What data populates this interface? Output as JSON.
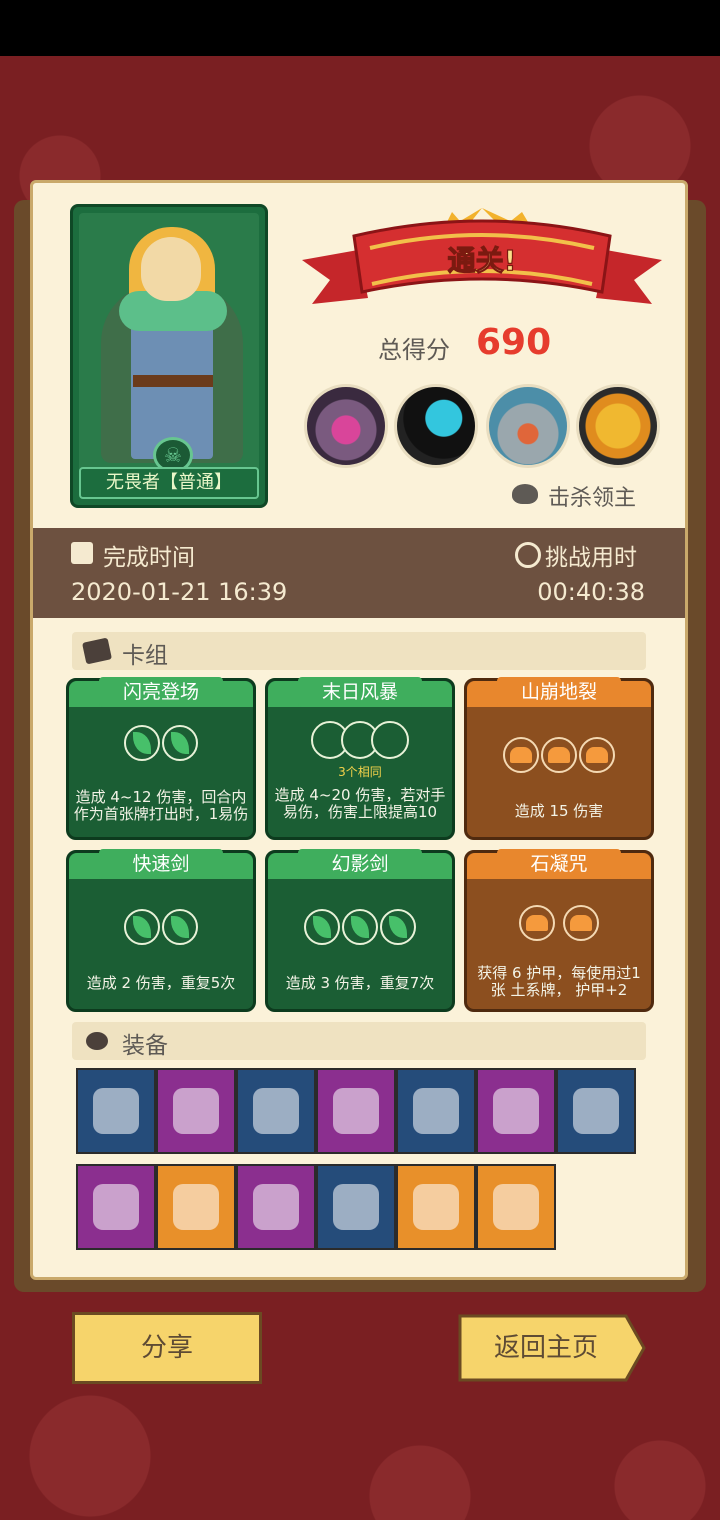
{
  "hero": {
    "name": "无畏者【普通】"
  },
  "banner": {
    "title": "通关!"
  },
  "score": {
    "label": "总得分",
    "value": "690"
  },
  "bosses": {
    "kill_label": "击杀领主",
    "portraits": [
      "boss-fortress",
      "boss-shadow",
      "boss-robot",
      "boss-sunflower"
    ]
  },
  "stats": {
    "finish_label": "完成时间",
    "finish_value": "2020-01-21 16:39",
    "duration_label": "挑战用时",
    "duration_value": "00:40:38"
  },
  "deck": {
    "section_label": "卡组",
    "cards": [
      {
        "title": "闪亮登场",
        "type": "green",
        "energy": 2,
        "desc": "造成 4~12 伤害，回合内作为首张牌打出时，1易伤"
      },
      {
        "title": "末日风暴",
        "type": "green",
        "energy": 3,
        "sub": "3个相同",
        "desc": "造成 4~20 伤害，若对手 易伤，伤害上限提高10"
      },
      {
        "title": "山崩地裂",
        "type": "orange",
        "energy": 3,
        "desc": "造成 15 伤害"
      },
      {
        "title": "快速剑",
        "type": "green",
        "energy": 2,
        "desc": "造成 2 伤害，重复5次"
      },
      {
        "title": "幻影剑",
        "type": "green",
        "energy": 3,
        "desc": "造成 3 伤害，重复7次"
      },
      {
        "title": "石凝咒",
        "type": "orange",
        "energy": 2,
        "desc": "获得 6 护甲，每使用过1张 土系牌， 护甲+2"
      }
    ]
  },
  "equipment": {
    "section_label": "装备",
    "row1": [
      "jar-icon",
      "green-gem-icon",
      "leaf-icon",
      "shatter-icon",
      "horn-icon",
      "heart-stone-icon",
      "crown-icon"
    ],
    "row2": [
      "rock-icon",
      "crystal-shield-icon",
      "dagger-icon",
      "ring-icon",
      "crab-armor-icon",
      "sun-badge-icon"
    ],
    "row1_colors": [
      "#254c7a",
      "#8b2f8f",
      "#254c7a",
      "#8b2f8f",
      "#254c7a",
      "#8b2f8f",
      "#254c7a"
    ],
    "row2_colors": [
      "#8b2f8f",
      "#e8902a",
      "#8b2f8f",
      "#254c7a",
      "#e8902a",
      "#e8902a"
    ]
  },
  "buttons": {
    "share": "分享",
    "home": "返回主页"
  }
}
